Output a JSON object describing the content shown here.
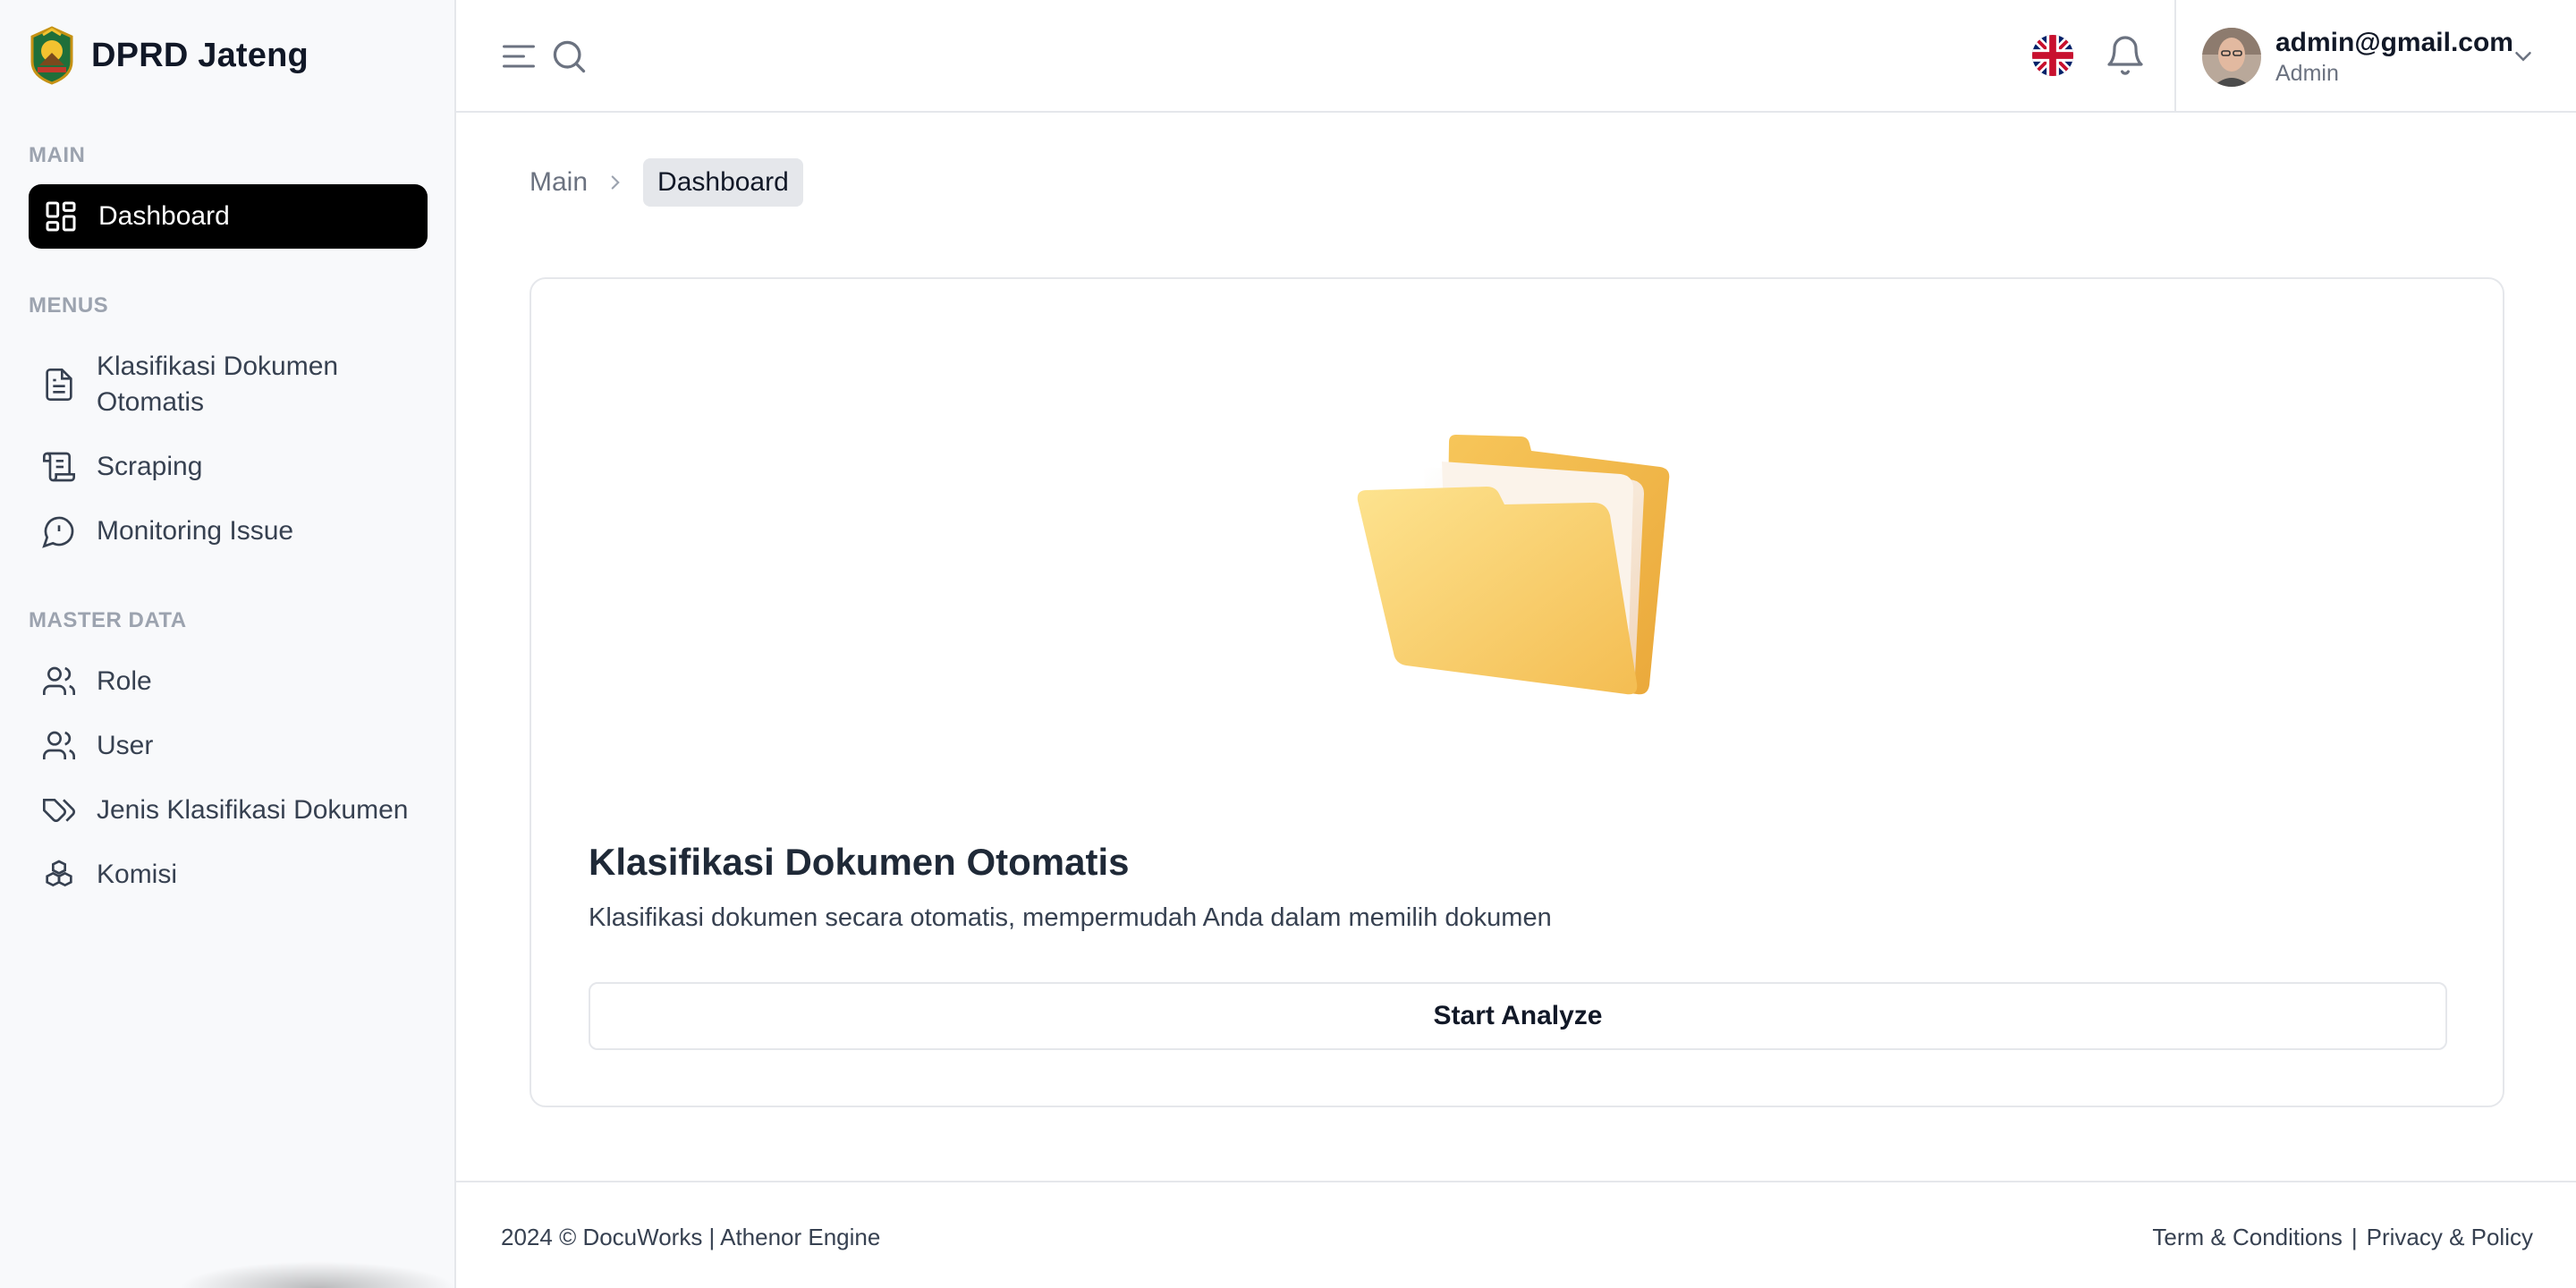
{
  "app": {
    "name": "DPRD Jateng"
  },
  "sidebar": {
    "sections": {
      "main": "MAIN",
      "menus": "MENUS",
      "master_data": "MASTER DATA"
    },
    "items": {
      "dashboard": {
        "label": "Dashboard",
        "icon": "dashboard-grid-icon"
      },
      "klasifikasi_line1": "Klasifikasi Dokumen",
      "klasifikasi_line2": "Otomatis",
      "scraping": {
        "label": "Scraping",
        "icon": "scroll-icon"
      },
      "monitoring": {
        "label": "Monitoring Issue",
        "icon": "message-alert-icon"
      },
      "role": {
        "label": "Role",
        "icon": "users-icon"
      },
      "user": {
        "label": "User",
        "icon": "users-icon"
      },
      "jenis": {
        "label": "Jenis Klasifikasi Dokumen",
        "icon": "tags-icon"
      },
      "komisi": {
        "label": "Komisi",
        "icon": "boxes-icon"
      }
    }
  },
  "topbar": {
    "user_email": "admin@gmail.com",
    "user_role": "Admin",
    "language_flag": "uk-flag-icon"
  },
  "breadcrumb": {
    "root": "Main",
    "current": "Dashboard"
  },
  "card": {
    "title": "Klasifikasi Dokumen Otomatis",
    "description": "Klasifikasi dokumen secara otomatis, mempermudah Anda dalam memilih dokumen",
    "button": "Start Analyze"
  },
  "footer": {
    "copyright": "2024 © DocuWorks | Athenor Engine",
    "terms": "Term & Conditions",
    "separator": "|",
    "privacy": "Privacy & Policy"
  },
  "colors": {
    "accent": "#000000",
    "sidebar_bg": "#f8f9fb",
    "folder": "#f6c75a"
  }
}
